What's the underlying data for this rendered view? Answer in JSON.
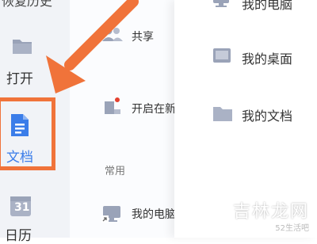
{
  "sidebar": {
    "top_cut": "恢复历史",
    "items": [
      {
        "label": "打开",
        "icon": "folder-icon"
      },
      {
        "label": "文档",
        "icon": "document-icon",
        "selected": true
      },
      {
        "label": "日历",
        "icon": "calendar-icon",
        "calendar_day": "31"
      }
    ]
  },
  "middle": {
    "share_label": "共享",
    "open_in_label": "开启在新",
    "section_common": "常用",
    "my_computer_label": "我的电脑"
  },
  "right": {
    "items": [
      {
        "label": "我的电脑",
        "icon": "computer-icon"
      },
      {
        "label": "我的桌面",
        "icon": "desktop-icon"
      },
      {
        "label": "我的文档",
        "icon": "folder-icon"
      }
    ]
  },
  "watermark": {
    "main": "吉林龙网",
    "sub": "52生活吧"
  },
  "colors": {
    "accent_orange": "#f0733a",
    "doc_blue": "#3b7de9",
    "icon_gray": "#9aa3b8"
  }
}
